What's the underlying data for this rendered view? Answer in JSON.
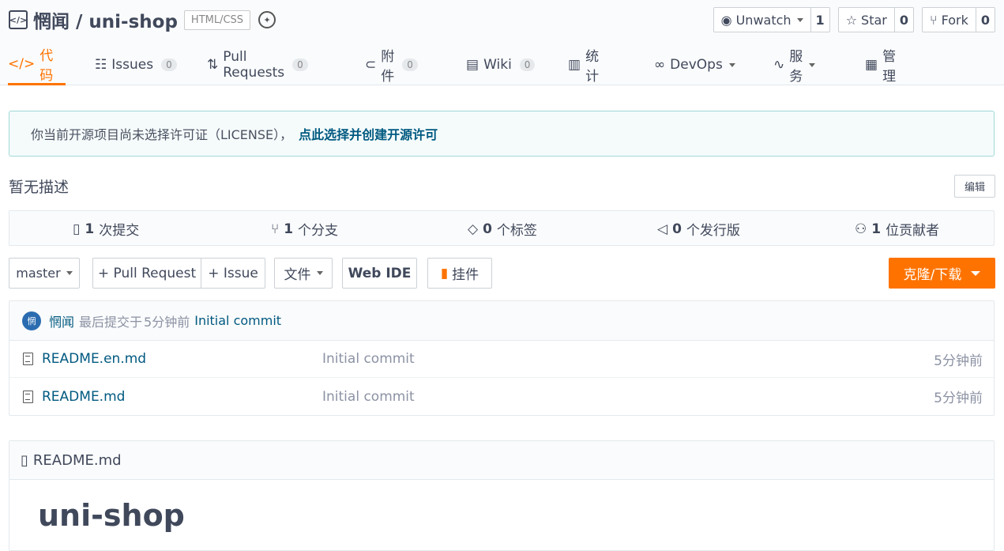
{
  "repo": {
    "title": "惘闻 / uni-shop",
    "language_tag": "HTML/CSS",
    "unwatch_label": "Unwatch",
    "watch_count": "1",
    "star_label": "Star",
    "star_count": "0",
    "fork_label": "Fork",
    "fork_count": "0"
  },
  "nav": {
    "code": "代码",
    "issues": "Issues",
    "issues_count": "0",
    "pull_requests": "Pull Requests",
    "pull_requests_count": "0",
    "attachments": "附件",
    "attachments_count": "0",
    "wiki": "Wiki",
    "wiki_count": "0",
    "stats": "统计",
    "devops": "DevOps",
    "services": "服务",
    "manage": "管理"
  },
  "license": {
    "text": "你当前开源项目尚未选择许可证（LICENSE），",
    "link": "点此选择并创建开源许可"
  },
  "description": {
    "text": "暂无描述",
    "edit_label": "编辑"
  },
  "stats": {
    "commits_num": "1",
    "commits_label": "次提交",
    "branches_num": "1",
    "branches_label": "个分支",
    "tags_num": "0",
    "tags_label": "个标签",
    "releases_num": "0",
    "releases_label": "个发行版",
    "contributors_num": "1",
    "contributors_label": "位贡献者"
  },
  "toolbar": {
    "branch": "master",
    "pull_request": "+ Pull Request",
    "issue": "+ Issue",
    "file": "文件",
    "web_ide": "Web IDE",
    "widget": "挂件",
    "clone": "克隆/下载"
  },
  "last_commit": {
    "avatar_text": "惘",
    "author": "惘闻",
    "prefix": "最后提交于",
    "time": "5分钟前",
    "message": "Initial commit"
  },
  "files": [
    {
      "name": "README.en.md",
      "message": "Initial commit",
      "time": "5分钟前"
    },
    {
      "name": "README.md",
      "message": "Initial commit",
      "time": "5分钟前"
    }
  ],
  "readme": {
    "filename": "README.md",
    "heading": "uni-shop"
  },
  "colors": {
    "accent": "#fe7300",
    "link": "#005980",
    "license_border": "#a0d9d8"
  }
}
